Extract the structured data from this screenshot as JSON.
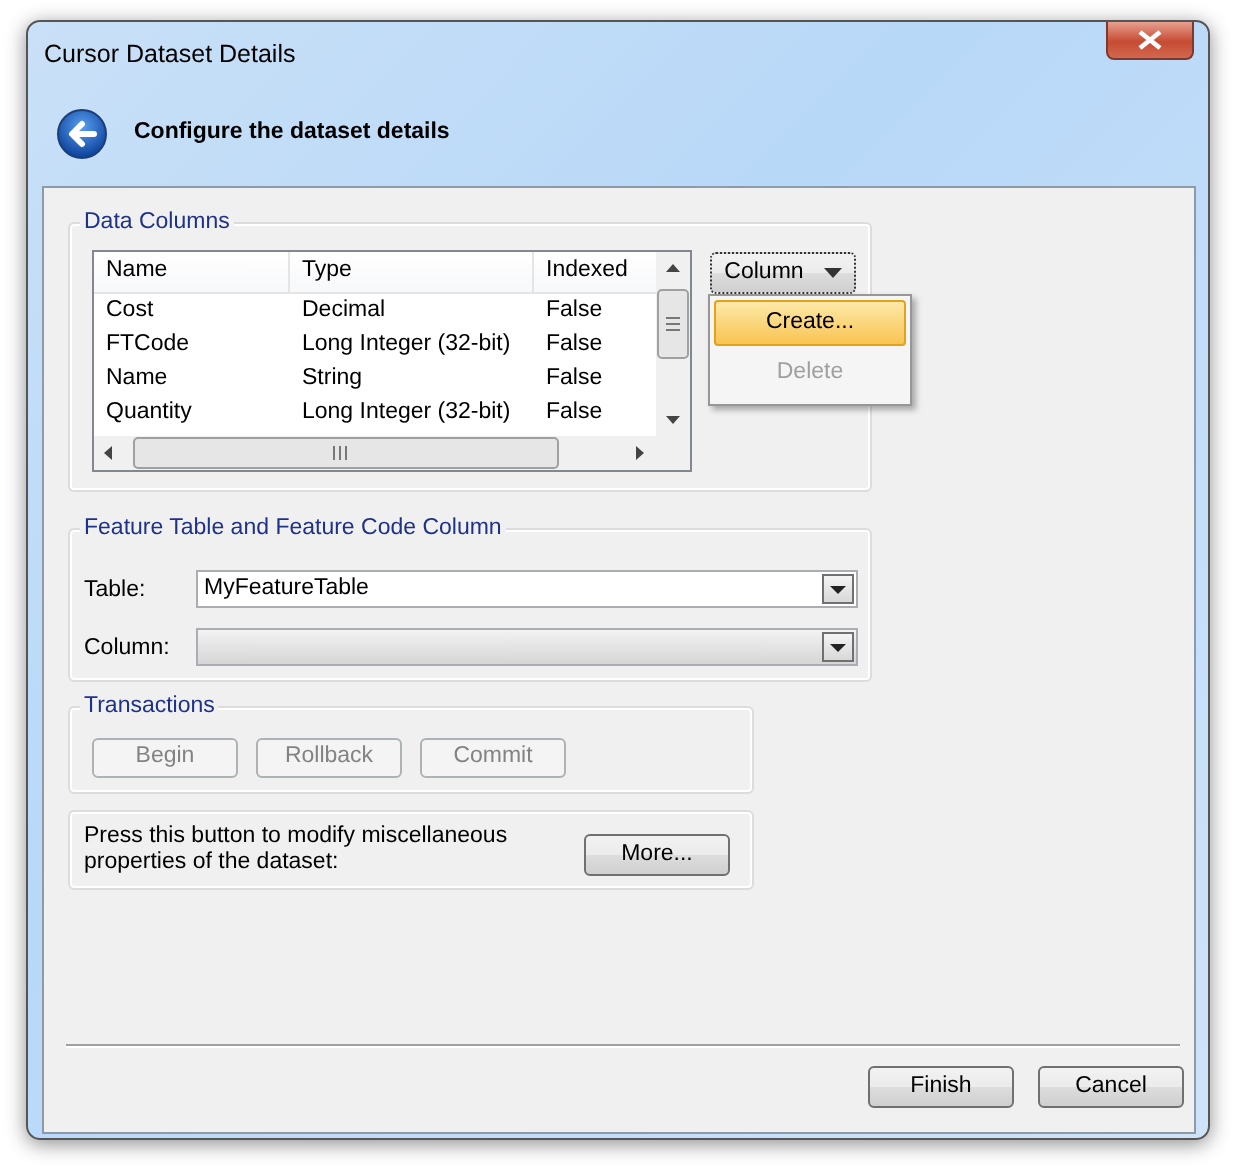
{
  "window": {
    "title": "Cursor Dataset Details"
  },
  "header": {
    "title": "Configure the dataset details"
  },
  "data_columns": {
    "title": "Data Columns",
    "columns": [
      "Name",
      "Type",
      "Indexed"
    ],
    "rows": [
      [
        "Cost",
        "Decimal",
        "False"
      ],
      [
        "FTCode",
        "Long Integer (32-bit)",
        "False"
      ],
      [
        "Name",
        "String",
        "False"
      ],
      [
        "Quantity",
        "Long Integer (32-bit)",
        "False"
      ]
    ],
    "column_button": "Column",
    "menu": [
      {
        "label": "Create...",
        "selected": true,
        "disabled": false
      },
      {
        "label": "Delete",
        "selected": false,
        "disabled": true
      }
    ]
  },
  "feature_table": {
    "title": "Feature Table and Feature Code Column",
    "fields": [
      {
        "label": "Table:",
        "value": "MyFeatureTable",
        "disabled": false
      },
      {
        "label": "Column:",
        "disabled": true
      }
    ]
  },
  "transactions": {
    "title": "Transactions",
    "buttons": [
      {
        "label": "Begin",
        "disabled": true
      },
      {
        "label": "Rollback",
        "disabled": true
      },
      {
        "label": "Commit",
        "disabled": true
      }
    ]
  },
  "misc": {
    "text": "Press this button to modify miscellaneous properties of the dataset:",
    "button": "More..."
  },
  "footer_buttons": [
    "Finish",
    "Cancel"
  ]
}
